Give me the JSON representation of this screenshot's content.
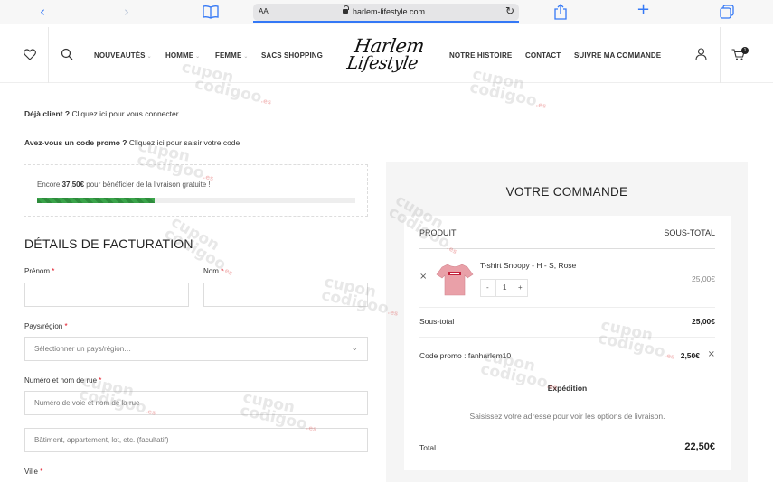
{
  "browser": {
    "text_size_label": "AA",
    "url": "harlem-lifestyle.com"
  },
  "header": {
    "nav_left": [
      "NOUVEAUTÉS",
      "HOMME",
      "FEMME",
      "SACS SHOPPING"
    ],
    "nav_right": [
      "NOTRE HISTOIRE",
      "CONTACT",
      "SUIVRE MA COMMANDE"
    ],
    "logo_line1": "Harlem",
    "logo_line2": "Lifestyle",
    "cart_count": "1"
  },
  "notices": {
    "returning_prefix": "Déjà client ?",
    "returning_link": "Cliquez ici pour vous connecter",
    "coupon_prefix": "Avez-vous un code promo ?",
    "coupon_link": "Cliquez ici pour saisir votre code"
  },
  "shipping": {
    "prefix": "Encore ",
    "amount": "37,50€",
    "suffix": " pour bénéficier de la livraison gratuite !",
    "progress": 0.37
  },
  "billing": {
    "title": "DÉTAILS DE FACTURATION",
    "first_name_label": "Prénom",
    "last_name_label": "Nom",
    "country_label": "Pays/région",
    "country_placeholder": "Sélectionner un pays/région…",
    "street_label": "Numéro et nom de rue",
    "street_placeholder": "Numéro de voie et nom de la rue",
    "street2_placeholder": "Bâtiment, appartement, lot, etc. (facultatif)",
    "city_label": "Ville",
    "required_mark": "*"
  },
  "order": {
    "title": "VOTRE COMMANDE",
    "col_product": "PRODUIT",
    "col_subtotal": "SOUS-TOTAL",
    "item_name": "T-shirt Snoopy - H - S, Rose",
    "item_qty": "1",
    "item_price": "25,00€",
    "qty_minus": "-",
    "qty_plus": "+",
    "subtotal_label": "Sous-total",
    "subtotal_value": "25,00€",
    "coupon_label": "Code promo : fanharlem10",
    "coupon_value": "2,50€",
    "shipping_label": "Expédition",
    "shipping_note": "Saisissez votre adresse pour voir les options de livraison.",
    "total_label": "Total",
    "total_value": "22,50€"
  },
  "watermark": {
    "line1": "cupon",
    "line2": "codigoo",
    "tld": ".es"
  },
  "colors": {
    "accent_blue": "#3478f6",
    "progress_green": "#2e8b3c",
    "required_red": "#e01020"
  }
}
